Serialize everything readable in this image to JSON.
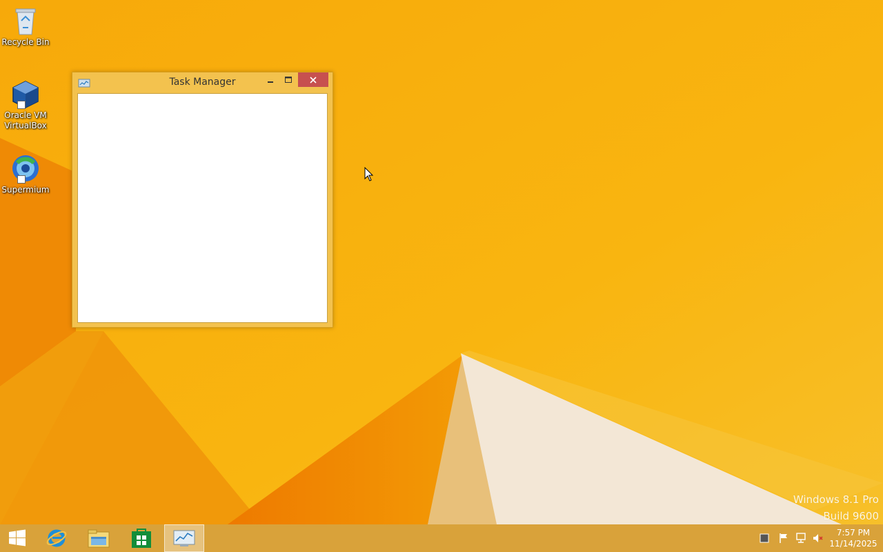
{
  "desktop": {
    "icons": [
      {
        "label": "Recycle Bin",
        "icon": "recycle-bin-icon"
      },
      {
        "label": "Oracle VM VirtualBox",
        "icon": "virtualbox-icon"
      },
      {
        "label": "Supermium",
        "icon": "supermium-icon"
      }
    ],
    "watermark": {
      "line1": "Windows 8.1 Pro",
      "line2": "Build 9600"
    }
  },
  "window": {
    "title": "Task Manager",
    "buttons": [
      "minimize",
      "maximize",
      "close"
    ]
  },
  "taskbar": {
    "pinned": [
      "start-icon",
      "internet-explorer-icon",
      "file-explorer-icon",
      "store-icon",
      "task-manager-icon"
    ],
    "active": "task-manager-icon",
    "tray": [
      "notification-icon",
      "action-center-flag-icon",
      "network-icon",
      "volume-muted-icon"
    ],
    "clock": {
      "time": "7:57 PM",
      "date": "11/14/2025"
    }
  },
  "colors": {
    "wallpaper": "#f6b10a",
    "taskbar": "#d9a23a",
    "window_frame": "#f3c24e",
    "close_button": "#c7504f"
  }
}
